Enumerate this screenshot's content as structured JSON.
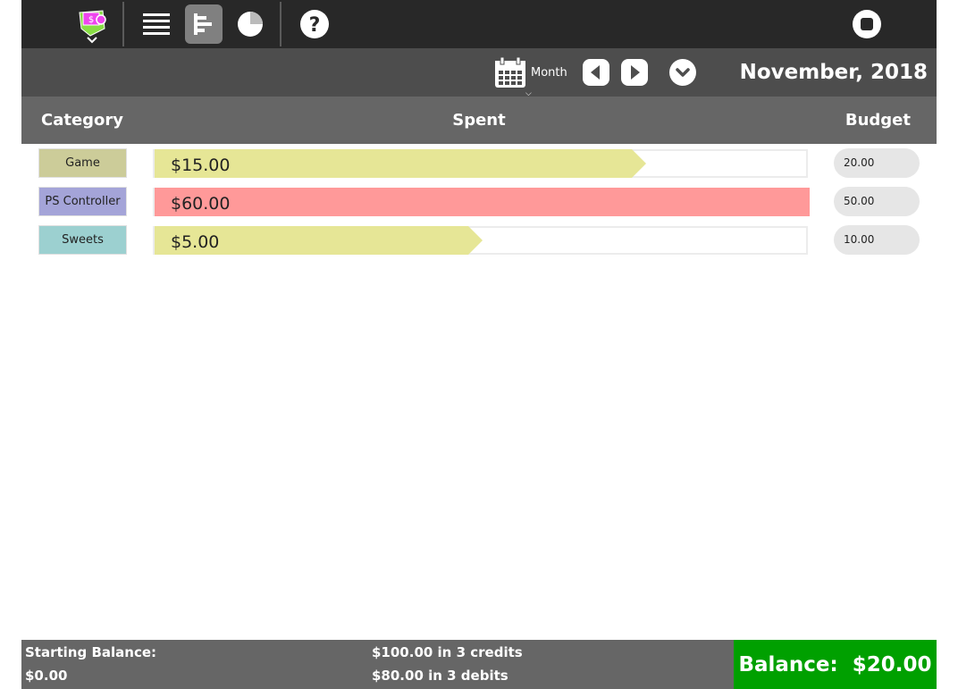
{
  "subbar": {
    "period_label": "Month",
    "title": "November, 2018"
  },
  "header": {
    "category": "Category",
    "spent": "Spent",
    "budget": "Budget"
  },
  "rows": [
    {
      "category": "Game",
      "spent": "$15.00",
      "budget": "20.00",
      "spent_fraction": 0.75,
      "cat_color": "#cccc99",
      "bar_color": "#e6e696"
    },
    {
      "category": "PS Controller",
      "spent": "$60.00",
      "budget": "50.00",
      "spent_fraction": 1.0,
      "cat_color": "#a4a4d8",
      "bar_color": "#ff9999"
    },
    {
      "category": "Sweets",
      "spent": "$5.00",
      "budget": "10.00",
      "spent_fraction": 0.5,
      "cat_color": "#9cd0d0",
      "bar_color": "#e6e696"
    }
  ],
  "footer": {
    "starting_label": "Starting Balance:",
    "starting_value": "$0.00",
    "credits": "$100.00 in 3 credits",
    "debits": "$80.00 in 3 debits",
    "balance_label": "Balance:",
    "balance_value": "$20.00"
  },
  "icons": {
    "activity": "activity-icon",
    "list_view": "list-view-icon",
    "chart_view": "bar-chart-view-icon",
    "pie_view": "pie-chart-view-icon",
    "help": "help-icon",
    "stop": "stop-icon",
    "calendar": "calendar-icon",
    "prev": "previous-icon",
    "next": "next-icon",
    "dropdown": "chevron-down-icon"
  }
}
